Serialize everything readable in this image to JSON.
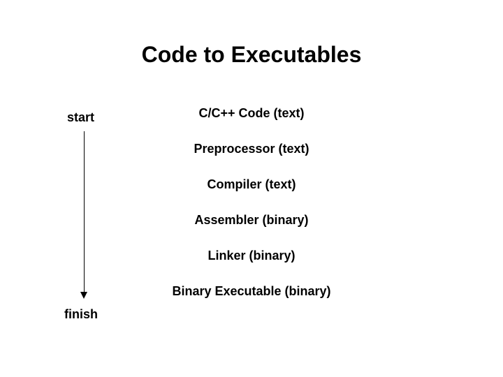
{
  "title": "Code to Executables",
  "labels": {
    "start": "start",
    "finish": "finish"
  },
  "stages": [
    "C/C++ Code (text)",
    "Preprocessor (text)",
    "Compiler (text)",
    "Assembler (binary)",
    "Linker (binary)",
    "Binary Executable (binary)"
  ]
}
